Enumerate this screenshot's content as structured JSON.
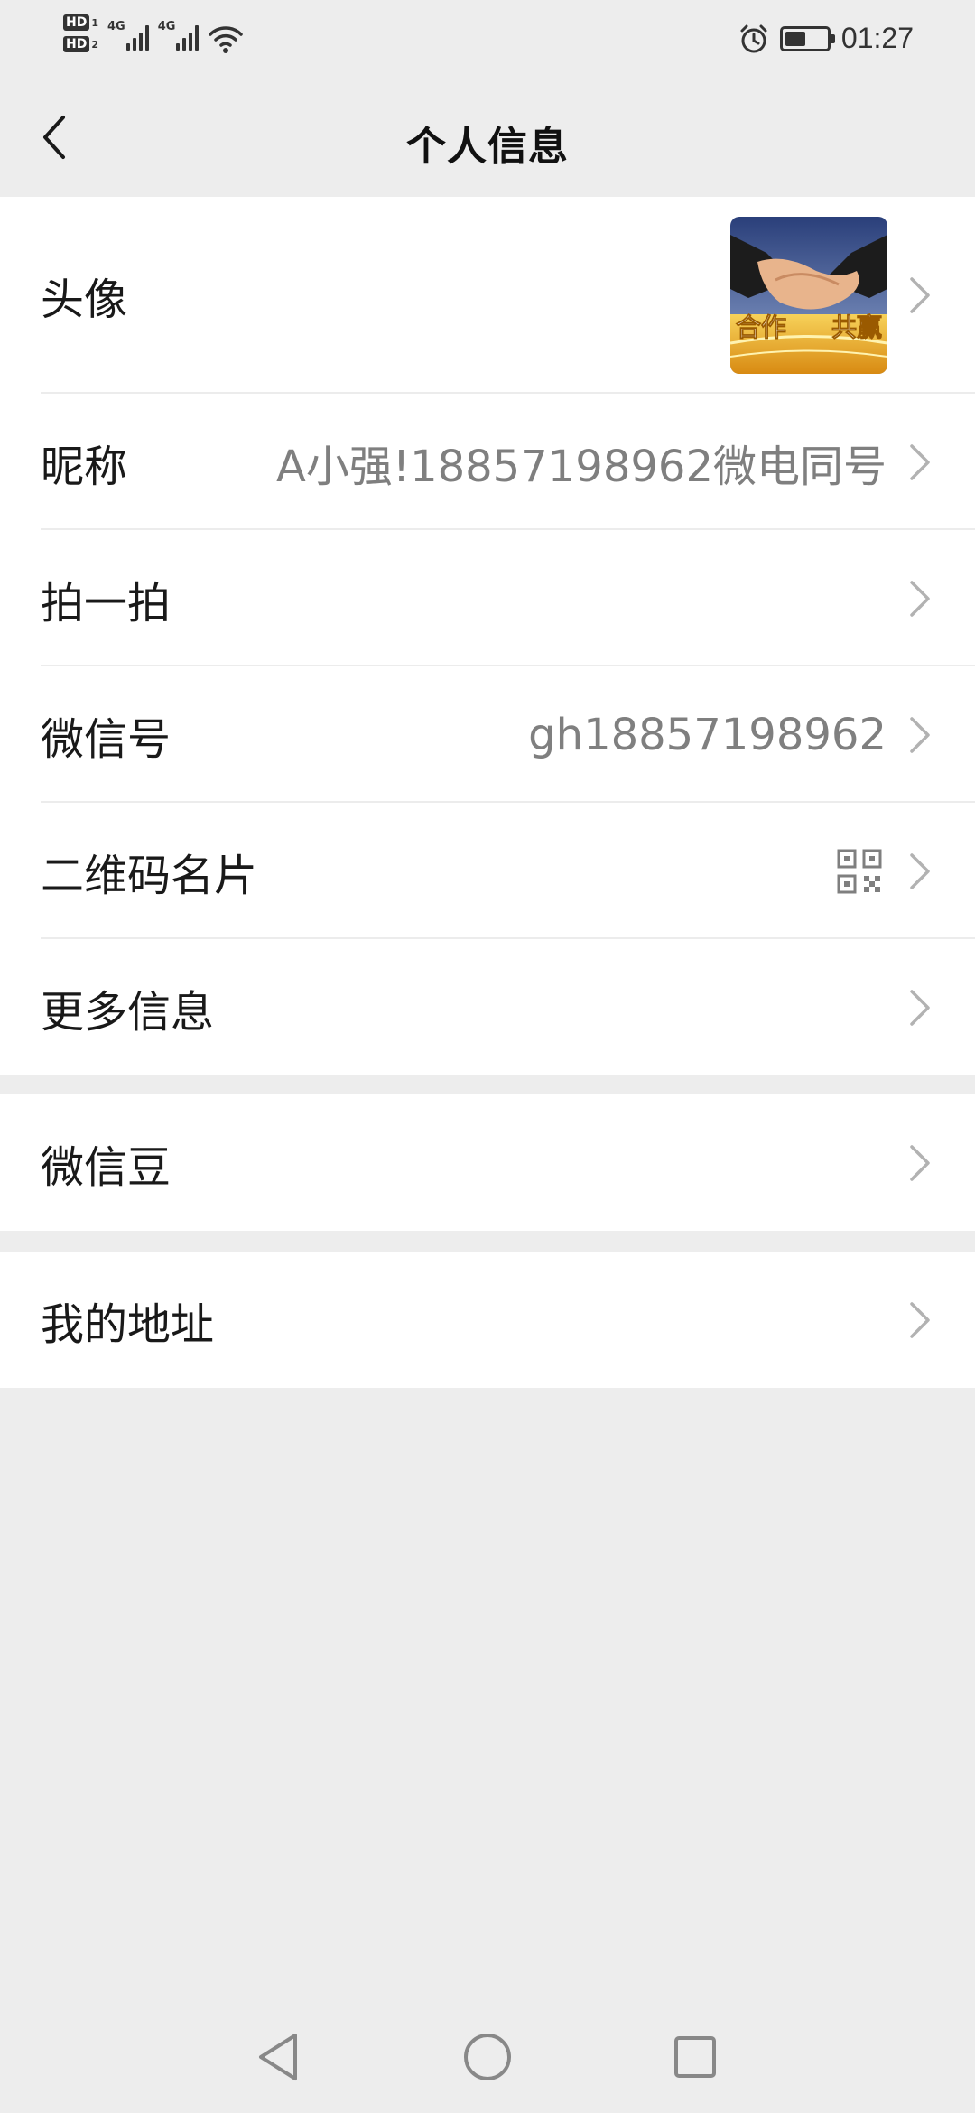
{
  "status_bar": {
    "time": "01:27",
    "sim1_label": "HD",
    "sim1_index": "1",
    "sim2_label": "HD",
    "sim2_index": "2",
    "network1": "4G",
    "network2": "4G",
    "icons": [
      "alarm-icon",
      "battery-icon",
      "wifi-icon",
      "signal-icon"
    ]
  },
  "header": {
    "title": "个人信息",
    "back_icon": "chevron-left-icon"
  },
  "profile_items": [
    {
      "label": "头像",
      "value": ""
    },
    {
      "label": "昵称",
      "value": "A小强!18857198962微电同号"
    },
    {
      "label": "拍一拍",
      "value": ""
    },
    {
      "label": "微信号",
      "value": "gh18857198962"
    },
    {
      "label": "二维码名片",
      "value": ""
    },
    {
      "label": "更多信息",
      "value": ""
    }
  ],
  "avatar_image": {
    "text_left": "合作",
    "text_right": "共赢"
  },
  "group2": [
    {
      "label": "微信豆"
    }
  ],
  "group3": [
    {
      "label": "我的地址"
    }
  ],
  "colors": {
    "background": "#ededed",
    "card": "#ffffff",
    "text": "#191919",
    "secondary_text": "#7f7f7f",
    "chevron": "#b2b2b2"
  }
}
